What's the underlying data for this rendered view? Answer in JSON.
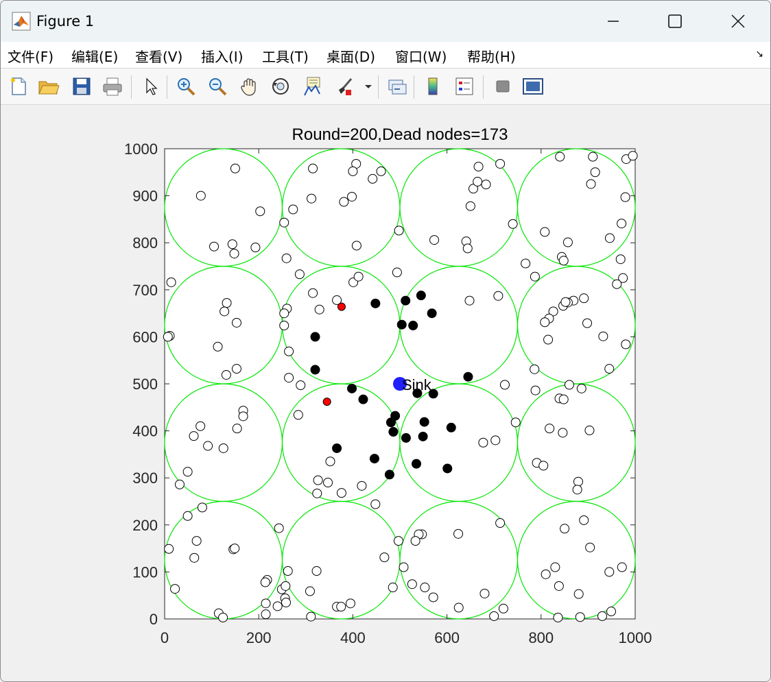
{
  "window": {
    "title": "Figure 1",
    "controls": {
      "minimize": "minimize",
      "maximize": "maximize",
      "close": "close"
    }
  },
  "menu": {
    "items": [
      {
        "label": "文件(F)"
      },
      {
        "label": "编辑(E)"
      },
      {
        "label": "查看(V)"
      },
      {
        "label": "插入(I)"
      },
      {
        "label": "工具(T)"
      },
      {
        "label": "桌面(D)"
      },
      {
        "label": "窗口(W)"
      },
      {
        "label": "帮助(H)"
      }
    ],
    "more_indicator": "↘"
  },
  "toolbar": {
    "icons": [
      "new-figure-icon",
      "open-file-icon",
      "save-icon",
      "print-icon",
      "select-arrow-icon",
      "zoom-in-icon",
      "zoom-out-icon",
      "pan-hand-icon",
      "rotate-3d-icon",
      "data-cursor-icon",
      "brush-icon",
      "brush-dropdown-icon",
      "link-plot-icon",
      "colorbar-icon",
      "legend-icon",
      "hide-plot-tools-icon",
      "show-plot-tools-icon"
    ]
  },
  "chart_data": {
    "type": "scatter",
    "title": "Round=200,Dead nodes=173",
    "xlabel": "",
    "ylabel": "",
    "xlim": [
      0,
      1000
    ],
    "ylim": [
      0,
      1000
    ],
    "xticks": [
      "0",
      "200",
      "400",
      "600",
      "800",
      "1000"
    ],
    "yticks": [
      "0",
      "100",
      "200",
      "300",
      "400",
      "500",
      "600",
      "700",
      "800",
      "900",
      "1000"
    ],
    "grid": false,
    "sink": {
      "x": 500,
      "y": 500,
      "label": "Sink",
      "color": "#1f1fff"
    },
    "cluster_circles": {
      "radius": 125,
      "color": "#00e600",
      "centers": [
        [
          125,
          125
        ],
        [
          375,
          125
        ],
        [
          625,
          125
        ],
        [
          875,
          125
        ],
        [
          125,
          375
        ],
        [
          375,
          375
        ],
        [
          625,
          375
        ],
        [
          875,
          375
        ],
        [
          125,
          625
        ],
        [
          375,
          625
        ],
        [
          625,
          625
        ],
        [
          875,
          625
        ],
        [
          125,
          875
        ],
        [
          375,
          875
        ],
        [
          625,
          875
        ],
        [
          875,
          875
        ]
      ]
    },
    "series": [
      {
        "style": "dead-hollow",
        "color": "#ffffff",
        "points": [
          [
            150,
            958
          ],
          [
            77,
            900
          ],
          [
            203,
            867
          ],
          [
            105,
            792
          ],
          [
            144,
            797
          ],
          [
            148,
            777
          ],
          [
            193,
            790
          ],
          [
            315,
            958
          ],
          [
            407,
            968
          ],
          [
            460,
            952
          ],
          [
            400,
            952
          ],
          [
            442,
            936
          ],
          [
            381,
            887
          ],
          [
            398,
            898
          ],
          [
            312,
            894
          ],
          [
            273,
            871
          ],
          [
            254,
            843
          ],
          [
            408,
            794
          ],
          [
            667,
            962
          ],
          [
            713,
            968
          ],
          [
            656,
            915
          ],
          [
            665,
            930
          ],
          [
            683,
            924
          ],
          [
            650,
            878
          ],
          [
            740,
            840
          ],
          [
            641,
            803
          ],
          [
            644,
            788
          ],
          [
            573,
            806
          ],
          [
            498,
            826
          ],
          [
            840,
            983
          ],
          [
            915,
            950
          ],
          [
            910,
            983
          ],
          [
            981,
            978
          ],
          [
            995,
            985
          ],
          [
            906,
            925
          ],
          [
            979,
            897
          ],
          [
            971,
            841
          ],
          [
            857,
            801
          ],
          [
            808,
            823
          ],
          [
            946,
            810
          ],
          [
            969,
            765
          ],
          [
            974,
            725
          ],
          [
            961,
            712
          ],
          [
            787,
            728
          ],
          [
            767,
            756
          ],
          [
            844,
            770
          ],
          [
            848,
            762
          ],
          [
            259,
            767
          ],
          [
            287,
            733
          ],
          [
            14,
            716
          ],
          [
            401,
            716
          ],
          [
            412,
            728
          ],
          [
            315,
            693
          ],
          [
            329,
            658
          ],
          [
            366,
            678
          ],
          [
            132,
            672
          ],
          [
            127,
            654
          ],
          [
            153,
            630
          ],
          [
            113,
            579
          ],
          [
            260,
            660
          ],
          [
            254,
            650
          ],
          [
            254,
            624
          ],
          [
            11,
            602
          ],
          [
            7,
            600
          ],
          [
            264,
            569
          ],
          [
            131,
            519
          ],
          [
            153,
            532
          ],
          [
            264,
            513
          ],
          [
            289,
            497
          ],
          [
            494,
            737
          ],
          [
            648,
            677
          ],
          [
            709,
            687
          ],
          [
            847,
            666
          ],
          [
            869,
            677
          ],
          [
            891,
            682
          ],
          [
            826,
            654
          ],
          [
            857,
            673
          ],
          [
            852,
            674
          ],
          [
            817,
            639
          ],
          [
            808,
            631
          ],
          [
            898,
            629
          ],
          [
            815,
            594
          ],
          [
            932,
            601
          ],
          [
            980,
            584
          ],
          [
            945,
            532
          ],
          [
            786,
            531
          ],
          [
            723,
            498
          ],
          [
            788,
            486
          ],
          [
            860,
            498
          ],
          [
            886,
            490
          ],
          [
            839,
            469
          ],
          [
            848,
            467
          ],
          [
            746,
            418
          ],
          [
            818,
            405
          ],
          [
            903,
            401
          ],
          [
            846,
            396
          ],
          [
            791,
            332
          ],
          [
            805,
            326
          ],
          [
            879,
            292
          ],
          [
            877,
            275
          ],
          [
            76,
            410
          ],
          [
            62,
            389
          ],
          [
            167,
            443
          ],
          [
            167,
            431
          ],
          [
            154,
            405
          ],
          [
            92,
            368
          ],
          [
            125,
            363
          ],
          [
            49,
            313
          ],
          [
            32,
            286
          ],
          [
            284,
            434
          ],
          [
            352,
            335
          ],
          [
            326,
            295
          ],
          [
            347,
            290
          ],
          [
            324,
            267
          ],
          [
            376,
            268
          ],
          [
            419,
            283
          ],
          [
            703,
            380
          ],
          [
            677,
            375
          ],
          [
            49,
            219
          ],
          [
            80,
            237
          ],
          [
            243,
            193
          ],
          [
            68,
            166
          ],
          [
            146,
            148
          ],
          [
            149,
            150
          ],
          [
            9,
            149
          ],
          [
            63,
            130
          ],
          [
            22,
            64
          ],
          [
            218,
            83
          ],
          [
            214,
            78
          ],
          [
            249,
            63
          ],
          [
            257,
            70
          ],
          [
            262,
            102
          ],
          [
            256,
            44
          ],
          [
            258,
            35
          ],
          [
            215,
            33
          ],
          [
            240,
            27
          ],
          [
            115,
            12
          ],
          [
            124,
            3
          ],
          [
            215,
            10
          ],
          [
            448,
            244
          ],
          [
            366,
            26
          ],
          [
            375,
            26
          ],
          [
            395,
            33
          ],
          [
            323,
            102
          ],
          [
            309,
            59
          ],
          [
            311,
            5
          ],
          [
            467,
            131
          ],
          [
            485,
            67
          ],
          [
            497,
            166
          ],
          [
            547,
            180
          ],
          [
            540,
            180
          ],
          [
            533,
            166
          ],
          [
            624,
            181
          ],
          [
            713,
            204
          ],
          [
            508,
            110
          ],
          [
            526,
            74
          ],
          [
            553,
            67
          ],
          [
            571,
            46
          ],
          [
            625,
            24
          ],
          [
            680,
            54
          ],
          [
            720,
            22
          ],
          [
            700,
            6
          ],
          [
            891,
            210
          ],
          [
            850,
            192
          ],
          [
            904,
            152
          ],
          [
            830,
            110
          ],
          [
            838,
            70
          ],
          [
            810,
            95
          ],
          [
            945,
            100
          ],
          [
            972,
            110
          ],
          [
            880,
            53
          ],
          [
            949,
            16
          ],
          [
            930,
            6
          ],
          [
            883,
            4
          ],
          [
            836,
            3
          ]
        ]
      },
      {
        "style": "alive",
        "color": "#000000",
        "points": [
          [
            448,
            671
          ],
          [
            512,
            677
          ],
          [
            545,
            688
          ],
          [
            568,
            650
          ],
          [
            504,
            626
          ],
          [
            528,
            624
          ],
          [
            320,
            600
          ],
          [
            320,
            530
          ],
          [
            645,
            515
          ],
          [
            398,
            490
          ],
          [
            422,
            467
          ],
          [
            490,
            432
          ],
          [
            537,
            480
          ],
          [
            571,
            479
          ],
          [
            481,
            418
          ],
          [
            486,
            398
          ],
          [
            513,
            385
          ],
          [
            552,
            419
          ],
          [
            549,
            388
          ],
          [
            609,
            407
          ],
          [
            366,
            363
          ],
          [
            446,
            341
          ],
          [
            478,
            307
          ],
          [
            535,
            330
          ],
          [
            601,
            320
          ]
        ]
      },
      {
        "style": "cluster-head",
        "color": "#ff0000",
        "points": [
          [
            376,
            664
          ],
          [
            345,
            462
          ]
        ]
      }
    ]
  }
}
